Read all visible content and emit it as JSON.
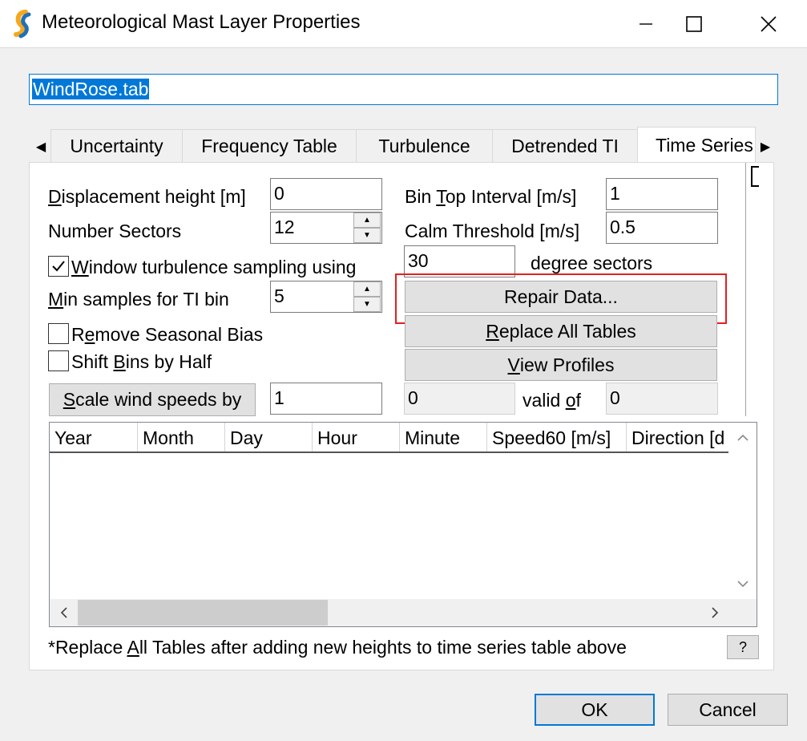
{
  "window": {
    "title": "Meteorological Mast Layer Properties",
    "icon": "app-logo-icon",
    "controls": {
      "minimize": "minimize-icon",
      "maximize": "maximize-icon",
      "close": "close-icon"
    }
  },
  "layer_name": "WindRose.tab",
  "tabs": [
    {
      "label": "Uncertainty",
      "active": false
    },
    {
      "label": "Frequency Table",
      "active": false
    },
    {
      "label": "Turbulence",
      "active": false
    },
    {
      "label": "Detrended TI",
      "active": false
    },
    {
      "label": "Time Series",
      "active": true
    }
  ],
  "left": {
    "displacement_label": {
      "pre": "",
      "u": "D",
      "post": "isplacement height [m]"
    },
    "displacement_value": "0",
    "sectors_label": "Number Sectors",
    "sectors_value": "12",
    "window_turbulence_label": {
      "pre": "",
      "u": "W",
      "post": "indow turbulence sampling using"
    },
    "window_turbulence_checked": true,
    "min_samples_label": {
      "pre": "",
      "u": "M",
      "post": "in samples for TI bin"
    },
    "min_samples_value": "5",
    "remove_seasonal_label": {
      "pre": "R",
      "u": "e",
      "post": "move Seasonal Bias"
    },
    "remove_seasonal_checked": false,
    "shift_bins_label": {
      "pre": "Shift ",
      "u": "B",
      "post": "ins by Half"
    },
    "shift_bins_checked": false,
    "scale_button": {
      "pre": "",
      "u": "S",
      "post": "cale wind speeds by"
    },
    "scale_value": "1"
  },
  "right": {
    "bin_top_label": {
      "pre": "Bin ",
      "u": "T",
      "post": "op Interval [m/s]"
    },
    "bin_top_value": "1",
    "calm_label": "Calm Threshold [m/s]",
    "calm_value": "0.5",
    "degree_value": "30",
    "degree_label": "degree sectors",
    "repair_button": "Repair Data...",
    "replace_button": {
      "pre": "",
      "u": "R",
      "post": "eplace All Tables"
    },
    "view_profiles_button": {
      "pre": "",
      "u": "V",
      "post": "iew Profiles"
    },
    "valid_count": "0",
    "valid_label": {
      "pre": "valid ",
      "u": "o",
      "post": "f"
    },
    "total_count": "0"
  },
  "grid": {
    "columns": [
      "Year",
      "Month",
      "Day",
      "Hour",
      "Minute",
      "Speed60 [m/s]",
      "Direction [d"
    ],
    "rows": []
  },
  "footnote": {
    "pre": "*Replace ",
    "u": "A",
    "post": "ll Tables after adding new heights to time series table above"
  },
  "help_button": "?",
  "ok_button": "OK",
  "cancel_button": "Cancel",
  "colors": {
    "accent": "#0078d7",
    "highlight": "#e31f1f"
  }
}
